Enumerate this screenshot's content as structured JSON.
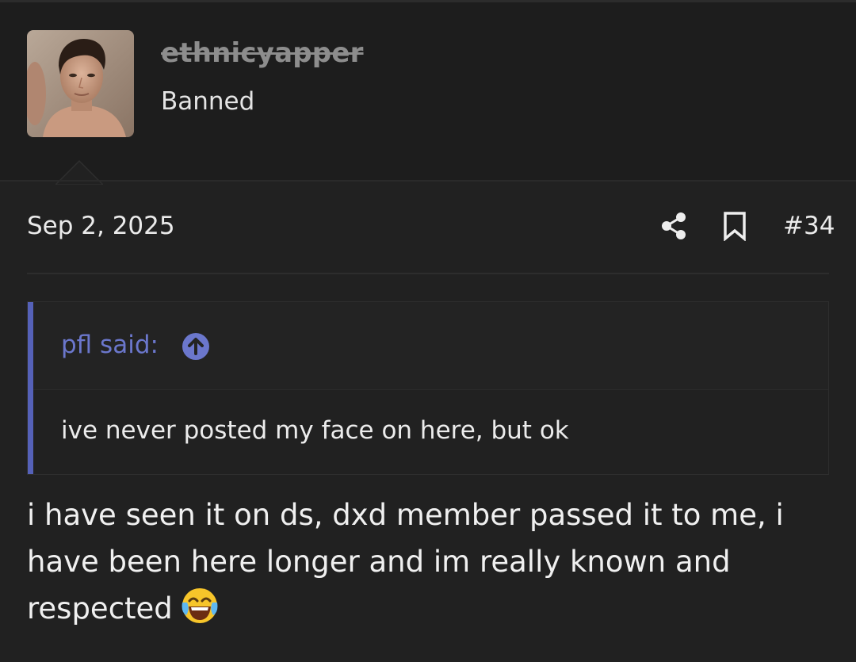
{
  "user": {
    "avatar_icon": "user-avatar-photo",
    "username": "ethnicyapper",
    "title": "Banned"
  },
  "post": {
    "date": "Sep 2, 2025",
    "share_icon": "share-icon",
    "bookmark_icon": "bookmark-icon",
    "number": "#34"
  },
  "quote": {
    "author_label": "pfl said:",
    "jump_icon": "arrow-up-circle-icon",
    "text": "ive never posted my face on here, but ok"
  },
  "message": {
    "text": "i have seen it on ds, dxd member passed it to me, i have been here longer and im really known and respected",
    "emoji": "face-with-tears-of-joy-emoji"
  },
  "colors": {
    "background": "#212121",
    "quote_accent": "#5561b8",
    "quote_author": "#6b77cc",
    "username_banned": "#8d8d8d"
  }
}
